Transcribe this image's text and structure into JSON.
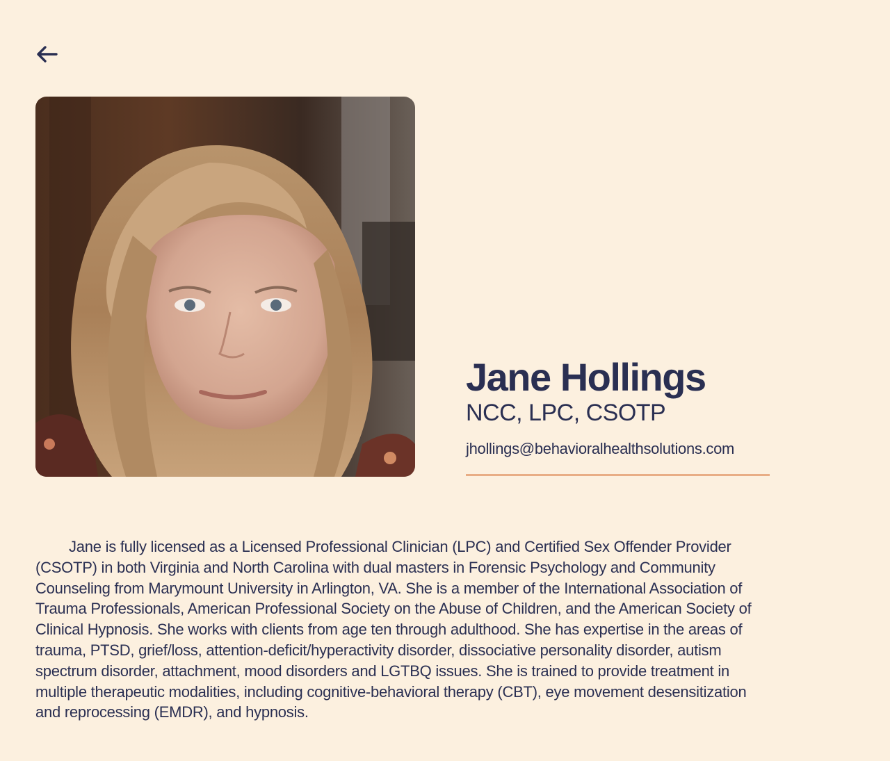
{
  "page": {
    "background_color": "#fcf0df",
    "text_color": "#2a2f52",
    "accent_color": "#e8ad85"
  },
  "nav": {
    "back_icon": "arrow-left-icon"
  },
  "profile": {
    "photo_alt": "Jane Hollings",
    "name": "Jane Hollings",
    "credentials": "NCC, LPC, CSOTP",
    "email": "jhollings@behavioralhealthsolutions.com",
    "bio": "Jane is fully licensed as a Licensed Professional Clinician (LPC) and Certified Sex Offender Provider (CSOTP) in both Virginia and North Carolina with dual masters in Forensic Psychology and Community Counseling from Marymount University in Arlington, VA. She is a member of the International Association of Trauma Professionals, American Professional Society on the Abuse of Children, and the American Society of Clinical Hypnosis. She works with clients from age ten through adulthood. She has expertise in the areas of trauma, PTSD, grief/loss, attention-deficit/hyperactivity disorder, dissociative personality disorder, autism spectrum disorder, attachment, mood disorders and LGTBQ issues. She is trained to provide treatment in multiple therapeutic modalities, including cognitive-behavioral therapy (CBT), eye movement desensitization and reprocessing (EMDR), and hypnosis."
  }
}
